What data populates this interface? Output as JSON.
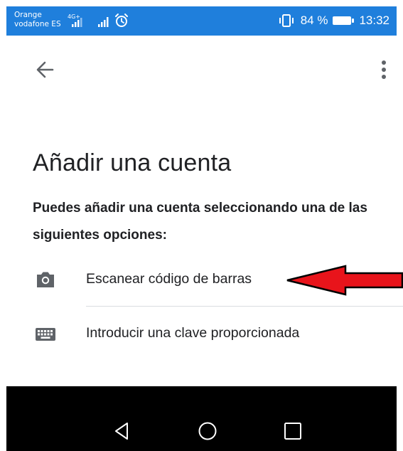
{
  "status_bar": {
    "carrier_line1": "Orange",
    "carrier_line2": "vodafone ES",
    "network_type": "4G+",
    "battery_percent": "84 %",
    "time": "13:32",
    "background_color": "#1f7fdc"
  },
  "app_bar": {
    "back_icon": "arrow-left-icon",
    "more_icon": "more-vert-icon"
  },
  "main": {
    "title": "Añadir una cuenta",
    "description": "Puedes añadir una cuenta seleccionando una de las siguientes opciones:",
    "options": [
      {
        "label": "Escanear código de barras",
        "icon": "camera-icon"
      },
      {
        "label": "Introducir una clave proporcionada",
        "icon": "keyboard-icon"
      }
    ]
  },
  "annotation": {
    "arrow_color": "#e8141b",
    "arrow_icon": "red-arrow-left-icon"
  },
  "nav_bar": {
    "back_icon": "triangle-back-icon",
    "home_icon": "circle-home-icon",
    "recents_icon": "square-recents-icon"
  }
}
